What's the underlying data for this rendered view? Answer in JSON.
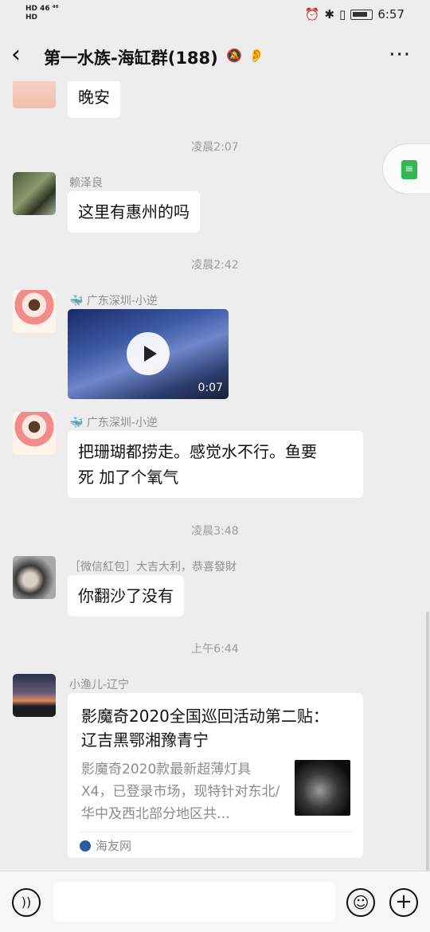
{
  "status_bar": {
    "left_top": "HD 46 ⁴⁶",
    "left_bottom": "HD",
    "time": "6:57"
  },
  "header": {
    "title": "第一水族-海缸群(188)",
    "back_icon": "chevron-left-icon",
    "more_icon": "ellipsis-icon"
  },
  "messages": {
    "m0_text": "晚安",
    "t1": "凌晨2:07",
    "m1_sender": "赖泽良",
    "m1_text": "这里有惠州的吗",
    "t2": "凌晨2:42",
    "m2_sender": "🐳 广东深圳-小逆",
    "m2_video_duration": "0:07",
    "m3_sender": "🐳 广东深圳-小逆",
    "m3_text_line1": "把珊瑚都捞走。感觉水不行。鱼要",
    "m3_text_line2": "死 加了个氧气",
    "t3": "凌晨3:48",
    "m4_sender": "［微信紅包］大吉大利，恭喜發財",
    "m4_text": "你翻沙了没有",
    "t4": "上午6:44",
    "m5_sender": "小渔儿-辽宁"
  },
  "link_card": {
    "title": "影魔奇2020全国巡回活动第二贴：  辽吉黑鄂湘豫青宁",
    "desc": "影魔奇2020款最新超薄灯具X4，已登录市场，现特针对东北/华中及西北部分地区共…",
    "source": "海友网"
  },
  "bottom_bar": {
    "voice_icon": "voice-icon",
    "emoji_icon": "emoji-icon",
    "plus_icon": "plus-icon"
  }
}
